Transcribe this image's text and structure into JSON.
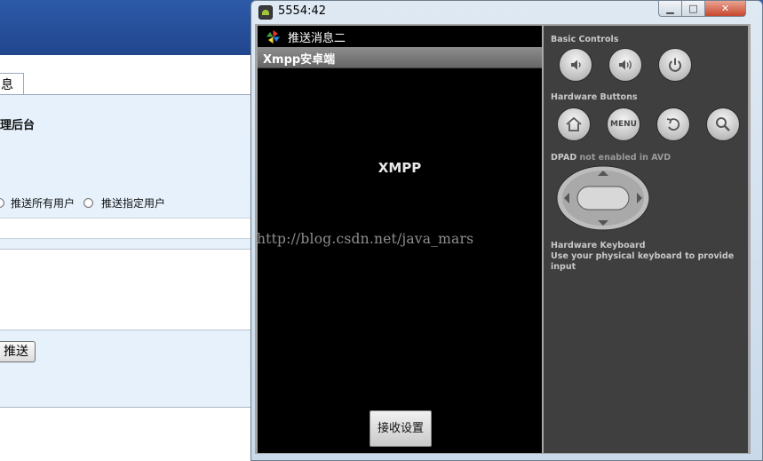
{
  "background_page": {
    "tab_label": "息",
    "section_title": "理后台",
    "radio_all_label": "推送所有用户",
    "radio_specific_label": "推送指定用户",
    "push_button_label": "推送"
  },
  "emulator": {
    "window_title": "5554:42",
    "window_buttons": {
      "minimize": "▁",
      "maximize": "□",
      "close": "✕"
    },
    "status_bar_notification": "推送消息二",
    "action_bar_title": "Xmpp安卓端",
    "center_text": "XMPP",
    "receive_settings_button": "接收设置",
    "controls": {
      "basic_controls_label": "Basic Controls",
      "hardware_buttons_label": "Hardware Buttons",
      "menu_label": "MENU",
      "dpad_label": "DPAD",
      "dpad_note": "not enabled in AVD",
      "hardware_keyboard_label": "Hardware Keyboard",
      "hardware_keyboard_hint": "Use your physical keyboard to provide input"
    },
    "basic_control_icons": [
      "volume-down-icon",
      "volume-up-icon",
      "power-icon"
    ],
    "hardware_button_icons": [
      "home-icon",
      "menu-button",
      "back-icon",
      "search-icon"
    ]
  },
  "watermark": "http://blog.csdn.net/java_mars",
  "colors": {
    "header_blue": "#2d5aa8",
    "panel_bg": "#e6f1fc",
    "controls_bg": "#3f3f3f",
    "screen_bg": "#000000"
  }
}
